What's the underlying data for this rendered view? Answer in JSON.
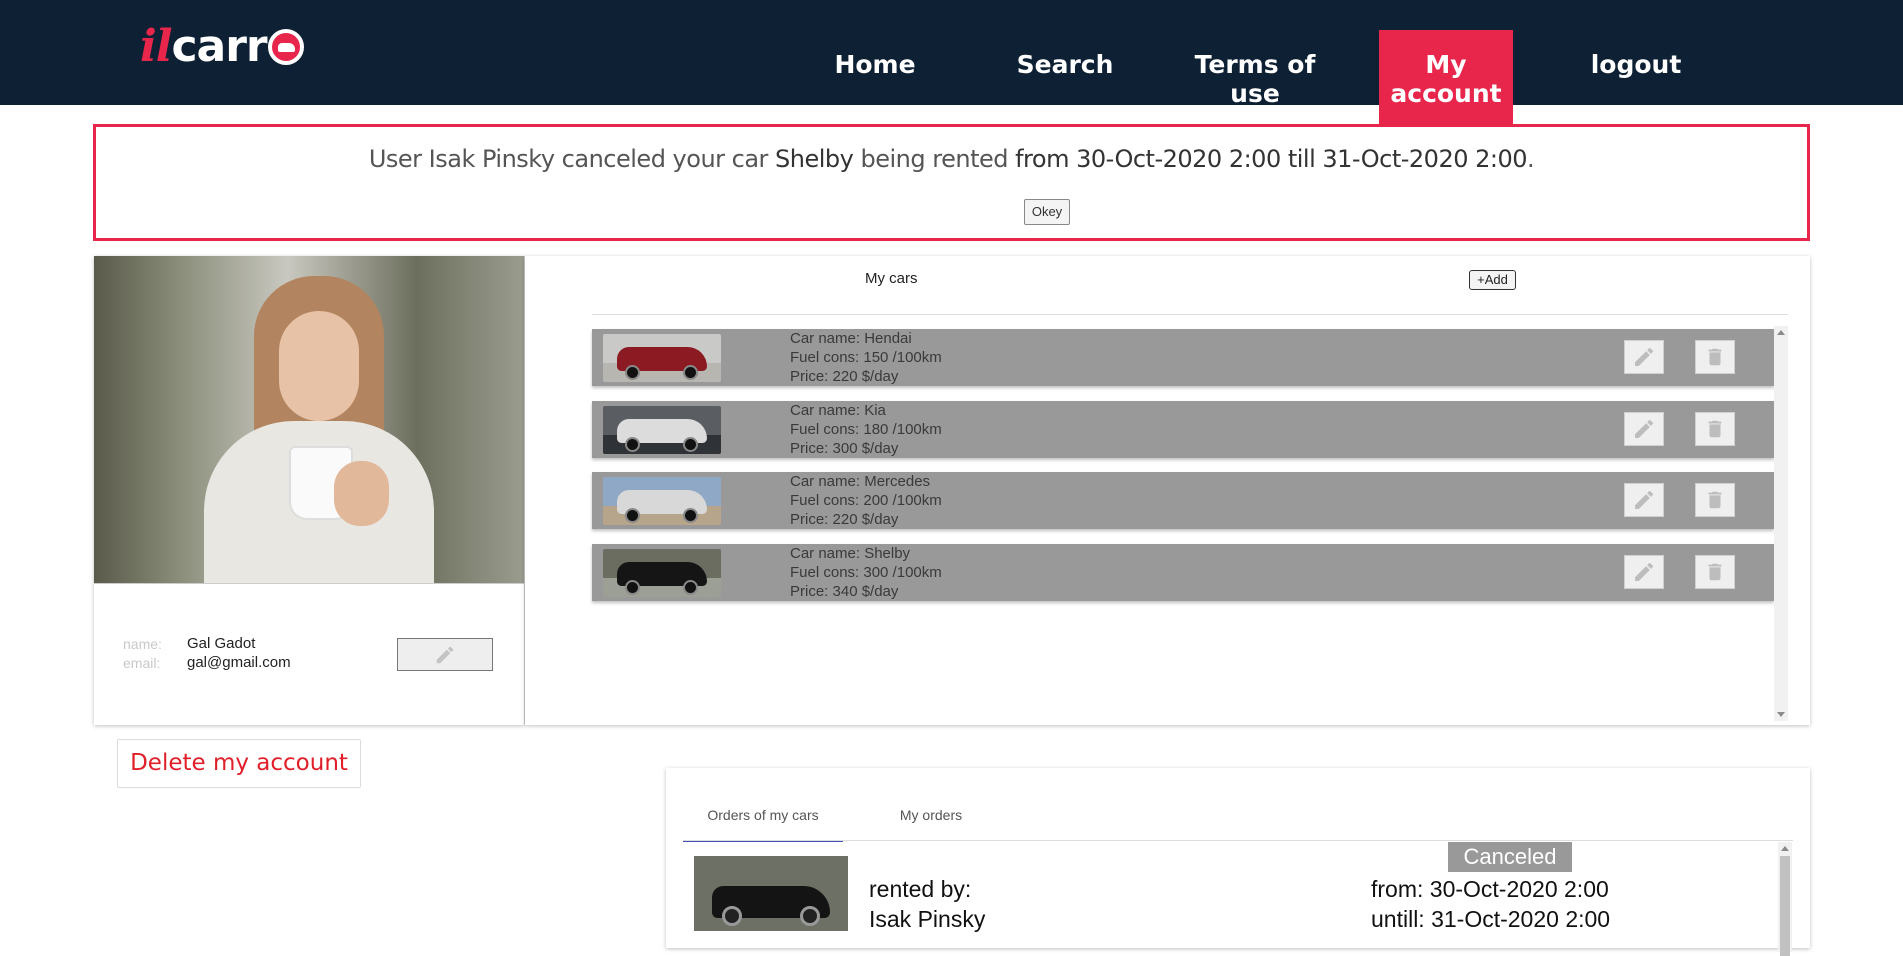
{
  "header": {
    "logo_prefix": "il",
    "logo_main": "carr",
    "nav": [
      {
        "label": "Home"
      },
      {
        "label": "Search"
      },
      {
        "label": "Terms of use"
      },
      {
        "label": "My account",
        "active": true
      },
      {
        "label": "logout"
      }
    ]
  },
  "notice": {
    "text_1": "User Isak Pinsky canceled your car ",
    "car_name": "Shelby",
    "text_2": " being rented ",
    "period": "from 30-Oct-2020 2:00 till 31-Oct-2020 2:00",
    "text_3": ".",
    "ok_label": "Okey"
  },
  "profile": {
    "name_label": "name:",
    "name_value": "Gal Gadot",
    "email_label": "email:",
    "email_value": "gal@gmail.com",
    "edit_icon": "pencil-icon"
  },
  "my_cars": {
    "title": "My cars",
    "add_label": "+Add",
    "cars": [
      {
        "name": "Car name: Hendai",
        "fuel": "Fuel cons: 150 /100km",
        "price": "Price: 220 $/day",
        "color": "#8c1a22",
        "sky": "#c9c9c7",
        "ground": "#b8b6b0"
      },
      {
        "name": "Car name: Kia",
        "fuel": "Fuel cons: 180 /100km",
        "price": "Price: 300 $/day",
        "color": "#dcdcdc",
        "sky": "#5a5e62",
        "ground": "#2f3236"
      },
      {
        "name": "Car name: Mercedes",
        "fuel": "Fuel cons: 200 /100km",
        "price": "Price: 220 $/day",
        "color": "#d8d8d8",
        "sky": "#8ea8c6",
        "ground": "#b6a58b"
      },
      {
        "name": "Car name: Shelby",
        "fuel": "Fuel cons: 300 /100km",
        "price": "Price: 340 $/day",
        "color": "#151515",
        "sky": "#6b6d60",
        "ground": "#9c9f95"
      }
    ]
  },
  "delete_account_label": "Delete my account",
  "orders": {
    "tabs": [
      {
        "label": "Orders of my cars",
        "active": true
      },
      {
        "label": "My orders",
        "active": false
      }
    ],
    "status": "Canceled",
    "rented_by_label": "rented by:",
    "renter": "Isak Pinsky",
    "from": "from: 30-Oct-2020 2:00",
    "until": "untill: 31-Oct-2020 2:00"
  }
}
